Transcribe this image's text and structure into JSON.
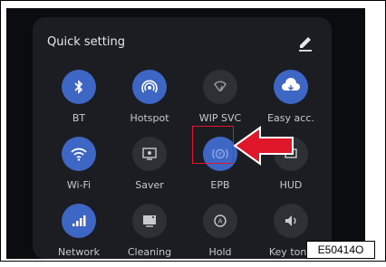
{
  "panel": {
    "title": "Quick setting",
    "edit_icon": "pencil-icon"
  },
  "tiles": [
    {
      "label": "BT",
      "icon": "bluetooth-icon",
      "active": true
    },
    {
      "label": "Hotspot",
      "icon": "hotspot-icon",
      "active": true
    },
    {
      "label": "WIP SVC",
      "icon": "wip-svc-icon",
      "active": false
    },
    {
      "label": "Easy acc.",
      "icon": "easy-access-icon",
      "active": true
    },
    {
      "label": "Wi-Fi",
      "icon": "wifi-icon",
      "active": true
    },
    {
      "label": "Saver",
      "icon": "saver-icon",
      "active": false
    },
    {
      "label": "EPB",
      "icon": "epb-icon",
      "active": true
    },
    {
      "label": "HUD",
      "icon": "hud-icon",
      "active": false
    },
    {
      "label": "Network",
      "icon": "network-signal-icon",
      "active": true
    },
    {
      "label": "Cleaning",
      "icon": "cleaning-icon",
      "active": false
    },
    {
      "label": "Hold",
      "icon": "hold-icon",
      "active": false
    },
    {
      "label": "Key tone",
      "icon": "key-tone-icon",
      "active": false
    }
  ],
  "annotation": {
    "highlight_color": "#e0162b",
    "arrow_color": "#e0162b",
    "figure_code": "E50414O"
  },
  "colors": {
    "active_tile": "#3d66c5",
    "inactive_tile": "#2e3036",
    "panel_bg": "#1b1d22"
  }
}
